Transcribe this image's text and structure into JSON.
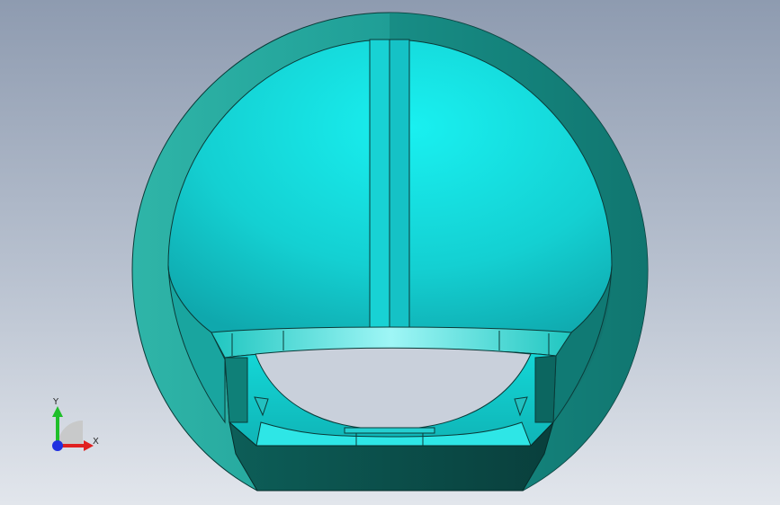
{
  "view": {
    "background_top": "#8e9bb0",
    "background_bottom": "#e2e6ec",
    "model_colors": {
      "outer_shell_light": "#2fb5a8",
      "outer_shell_dark": "#0f6b66",
      "inner_face": "#16d6d6",
      "highlight": "#8ff4f4",
      "base_dark": "#0a4e4a"
    }
  },
  "triad": {
    "y_axis_label": "Y",
    "x_axis_label": "X",
    "y_axis_color": "#1fbf2a",
    "x_axis_color": "#e02020",
    "z_axis_color": "#2030e0"
  }
}
